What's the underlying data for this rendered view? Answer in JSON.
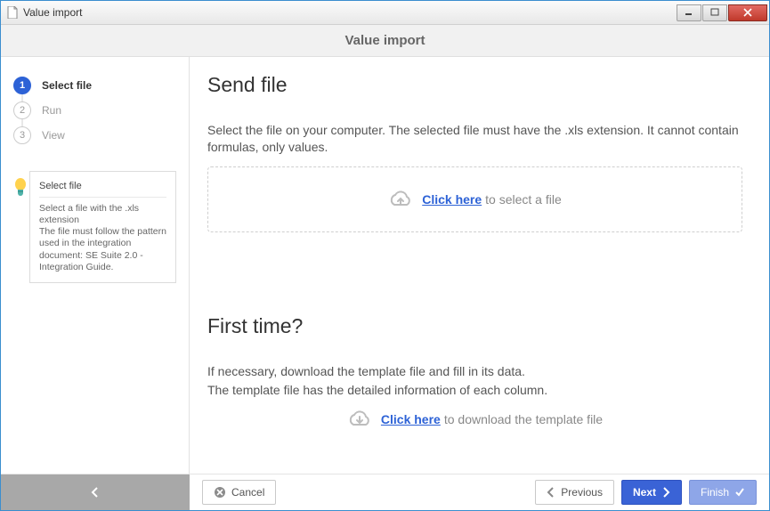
{
  "window": {
    "title": "Value import"
  },
  "header": {
    "title": "Value import"
  },
  "steps": [
    {
      "num": "1",
      "label": "Select file",
      "active": true
    },
    {
      "num": "2",
      "label": "Run",
      "active": false
    },
    {
      "num": "3",
      "label": "View",
      "active": false
    }
  ],
  "tip": {
    "title": "Select file",
    "l1": "Select a file with the .xls extension",
    "l2": "The file must follow the pattern used in the integration document: SE Suite 2.0 - Integration Guide."
  },
  "send": {
    "heading": "Send file",
    "desc": "Select the file on your computer. The selected file must have the .xls extension. It cannot contain formulas, only values.",
    "link": "Click here",
    "tail": "to select a file"
  },
  "first": {
    "heading": "First time?",
    "l1": "If necessary, download the template file and fill in its data.",
    "l2": "The template file has the detailed information of each column.",
    "link": "Click here",
    "tail": "to download the template file"
  },
  "footer": {
    "cancel": "Cancel",
    "previous": "Previous",
    "next": "Next",
    "finish": "Finish"
  }
}
